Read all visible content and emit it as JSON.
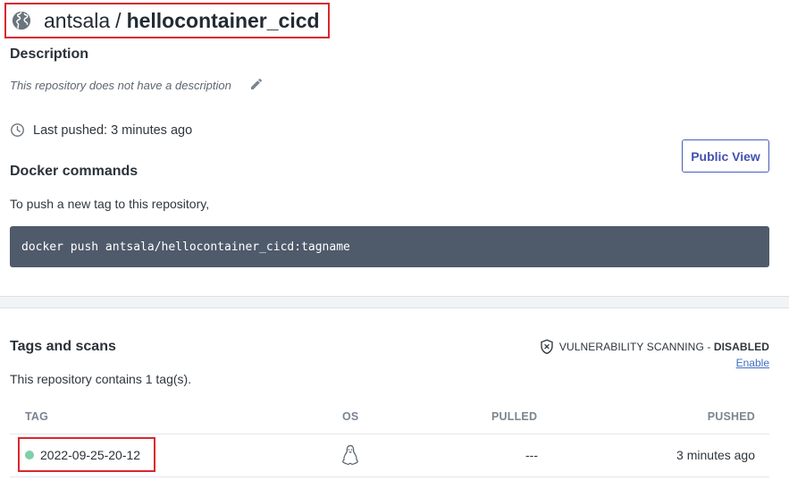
{
  "repo": {
    "namespace": "antsala",
    "separator": "/",
    "name": "hellocontainer_cicd"
  },
  "description": {
    "heading": "Description",
    "text": "This repository does not have a description"
  },
  "last_pushed": "Last pushed: 3 minutes ago",
  "public_view_label": "Public View",
  "docker": {
    "heading": "Docker commands",
    "text": "To push a new tag to this repository,",
    "command": "docker push antsala/hellocontainer_cicd:tagname"
  },
  "tags": {
    "heading": "Tags and scans",
    "vuln_label": "VULNERABILITY SCANNING",
    "vuln_sep": " - ",
    "vuln_status": "DISABLED",
    "enable_label": "Enable",
    "count_text": "This repository contains 1 tag(s).",
    "columns": {
      "tag": "TAG",
      "os": "OS",
      "pulled": "PULLED",
      "pushed": "PUSHED"
    },
    "rows": [
      {
        "tag": "2022-09-25-20-12",
        "os_icon": "linux-icon",
        "pulled": "---",
        "pushed": "3 minutes ago",
        "status_color": "#7fcfa8"
      }
    ]
  },
  "colors": {
    "highlight_border": "#d9262f",
    "accent": "#4151b0",
    "code_bg": "#4f5a6b",
    "link": "#3f6ec2"
  }
}
